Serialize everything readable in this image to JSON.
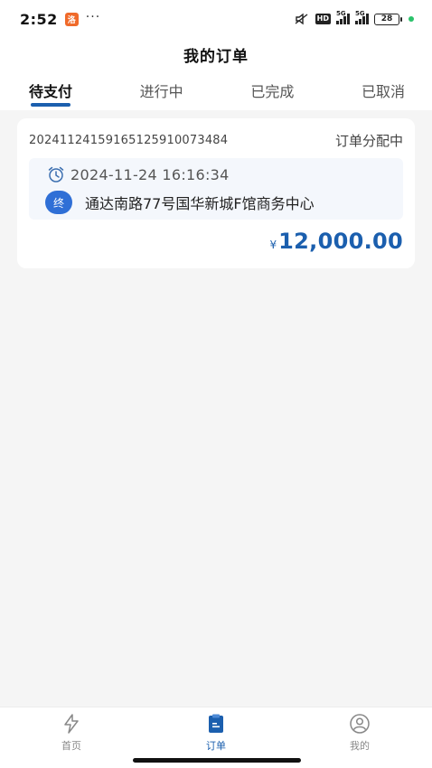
{
  "status_bar": {
    "time": "2:52",
    "app_badge": "洛",
    "dots": "···",
    "hd": "HD",
    "signal1_tag": "5G",
    "signal2_tag": "5G",
    "battery": "28"
  },
  "header": {
    "title": "我的订单"
  },
  "tabs": [
    {
      "label": "待支付",
      "active": true
    },
    {
      "label": "进行中",
      "active": false
    },
    {
      "label": "已完成",
      "active": false
    },
    {
      "label": "已取消",
      "active": false
    }
  ],
  "order": {
    "number": "20241124159165125910073484",
    "status": "订单分配中",
    "time": "2024-11-24 16:16:34",
    "dest_badge": "终",
    "destination": "通达南路77号国华新城F馆商务中心",
    "currency": "¥",
    "price": "12,000.00"
  },
  "bottom_nav": [
    {
      "label": "首页",
      "icon": "lightning-icon",
      "active": false
    },
    {
      "label": "订单",
      "icon": "clipboard-icon",
      "active": true
    },
    {
      "label": "我的",
      "icon": "user-icon",
      "active": false
    }
  ],
  "colors": {
    "accent": "#1b5fae",
    "badge": "#2f6fd6",
    "background": "#f5f5f5"
  }
}
